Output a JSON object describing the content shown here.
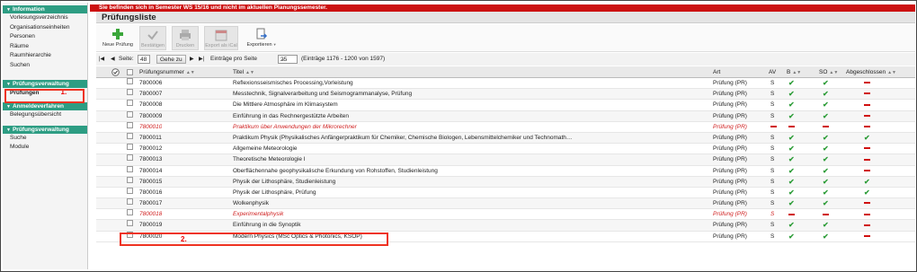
{
  "sidebar": {
    "sections": [
      {
        "title": "Information",
        "items": [
          "Vorlesungsverzeichnis",
          "Organisationseinheiten",
          "Personen",
          "Räume",
          "Raumhierarchie",
          "Suchen"
        ]
      },
      {
        "title": "Prüfungsverwaltung",
        "items": [
          "Prüfungen"
        ]
      },
      {
        "title": "Anmeldeverfahren",
        "items": [
          "Belegungsübersicht"
        ]
      },
      {
        "title": "Prüfungsverwaltung",
        "items": [
          "Suche",
          "Module"
        ]
      }
    ],
    "annotation": "1."
  },
  "alert": "Sie befinden sich in Semester WS 15/16 und nicht im aktuellen Planungssemester.",
  "title": "Prüfungsliste",
  "toolbar": {
    "new": "Neue Prüfung",
    "confirm": "Bestätigen",
    "print": "Drucken",
    "ical": "Export als iCal",
    "export": "Exportieren"
  },
  "pager": {
    "label": "Seite:",
    "page": "48",
    "go": "Gehe zu",
    "per_page": "25",
    "per_page_label": "Einträge pro Seite",
    "range": "(Einträge 1176 - 1200 von 1597)"
  },
  "columns": {
    "nr": "Prüfungsnummer",
    "title": "Titel",
    "art": "Art",
    "av": "AV",
    "b": "B",
    "so": "SO",
    "abg": "Abgeschlossen"
  },
  "rows": [
    {
      "nr": "7800006",
      "title": "Reflexionsseismisches Processing,Vorleistung",
      "art": "Prüfung (PR)",
      "av": "S",
      "b": "check",
      "so": "check",
      "abg": "dash",
      "red": false
    },
    {
      "nr": "7800007",
      "title": "Messtechnik, Signalverarbeitung und Seismogrammanalyse, Prüfung",
      "art": "Prüfung (PR)",
      "av": "S",
      "b": "check",
      "so": "check",
      "abg": "dash",
      "red": false
    },
    {
      "nr": "7800008",
      "title": "Die Mittlere Atmosphäre im Klimasystem",
      "art": "Prüfung (PR)",
      "av": "S",
      "b": "check",
      "so": "check",
      "abg": "dash",
      "red": false
    },
    {
      "nr": "7800009",
      "title": "Einführung in das Rechnergestützte Arbeiten",
      "art": "Prüfung (PR)",
      "av": "S",
      "b": "check",
      "so": "check",
      "abg": "dash",
      "red": false
    },
    {
      "nr": "7800010",
      "title": "Praktikum über Anwendungen der Mikrorechner",
      "art": "Prüfung (PR)",
      "av": "dash",
      "b": "dash",
      "so": "dash",
      "abg": "dash",
      "red": true
    },
    {
      "nr": "7800011",
      "title": "Praktikum Physik (Physikalisches Anfängerpraktikum für Chemiker, Chemische Biologen, Lebensmittelchemiker und Technomath…",
      "art": "Prüfung (PR)",
      "av": "S",
      "b": "check",
      "so": "check",
      "abg": "check",
      "red": false
    },
    {
      "nr": "7800012",
      "title": "Allgemeine Meteorologie",
      "art": "Prüfung (PR)",
      "av": "S",
      "b": "check",
      "so": "check",
      "abg": "dash",
      "red": false
    },
    {
      "nr": "7800013",
      "title": "Theoretische Meteorologie I",
      "art": "Prüfung (PR)",
      "av": "S",
      "b": "check",
      "so": "check",
      "abg": "dash",
      "red": false
    },
    {
      "nr": "7800014",
      "title": "Oberflächennahe geophysikalische Erkundung von Rohstoffen, Studienleistung",
      "art": "Prüfung (PR)",
      "av": "S",
      "b": "check",
      "so": "check",
      "abg": "dash",
      "red": false
    },
    {
      "nr": "7800015",
      "title": "Physik der Lithosphäre, Studienleistung",
      "art": "Prüfung (PR)",
      "av": "S",
      "b": "check",
      "so": "check",
      "abg": "check",
      "red": false
    },
    {
      "nr": "7800016",
      "title": "Physik der Lithosphäre, Prüfung",
      "art": "Prüfung (PR)",
      "av": "S",
      "b": "check",
      "so": "check",
      "abg": "check",
      "red": false
    },
    {
      "nr": "7800017",
      "title": "Wolkenphysik",
      "art": "Prüfung (PR)",
      "av": "S",
      "b": "check",
      "so": "check",
      "abg": "dash",
      "red": false
    },
    {
      "nr": "7800018",
      "title": "Experimentalphysik",
      "art": "Prüfung (PR)",
      "av": "S",
      "b": "dash",
      "so": "dash",
      "abg": "dash",
      "red": true
    },
    {
      "nr": "7800019",
      "title": "Einführung in die Synoptik",
      "art": "Prüfung (PR)",
      "av": "S",
      "b": "check",
      "so": "check",
      "abg": "dash",
      "red": false
    },
    {
      "nr": "7800020",
      "title": "Modern Physics (MSc Optics & Photonics, KSOP)",
      "art": "Prüfung (PR)",
      "av": "S",
      "b": "check",
      "so": "check",
      "abg": "dash",
      "red": false
    }
  ],
  "row_annotation": "2."
}
